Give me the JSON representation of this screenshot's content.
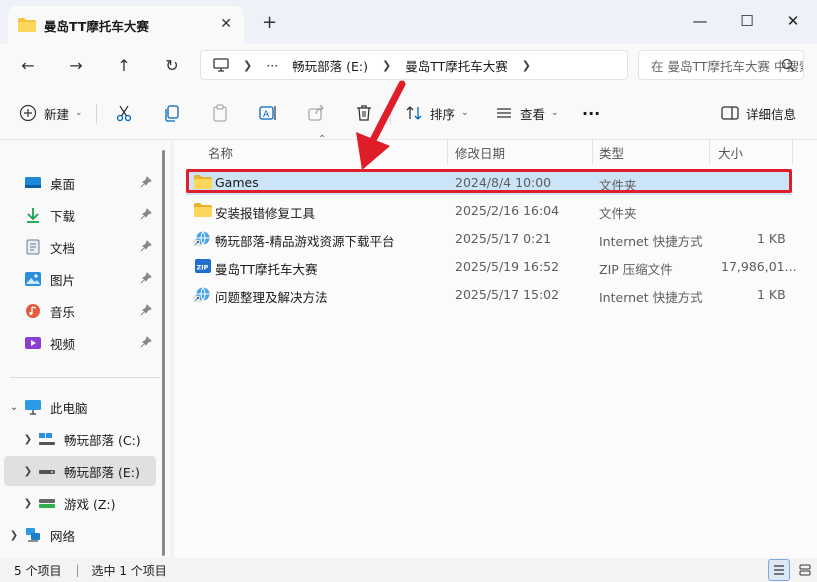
{
  "window": {
    "tab_title": "曼岛TT摩托车大赛",
    "new_tab": "+",
    "tab_close": "✕",
    "minimize": "—",
    "maximize": "☐",
    "close": "✕"
  },
  "nav": {
    "back": "←",
    "forward": "→",
    "up": "↑",
    "refresh": "↻",
    "breadcrumb": [
      "畅玩部落 (E:)",
      "曼岛TT摩托车大赛"
    ],
    "ellipsis": "···",
    "search_placeholder": "在 曼岛TT摩托车大赛 中搜索"
  },
  "toolbar": {
    "new_label": "新建",
    "sort_label": "排序",
    "view_label": "查看",
    "more_label": "···",
    "details_label": "详细信息"
  },
  "sidebar": {
    "quick": [
      {
        "label": "桌面",
        "icon": "desktop-icon"
      },
      {
        "label": "下载",
        "icon": "download-icon"
      },
      {
        "label": "文档",
        "icon": "document-icon"
      },
      {
        "label": "图片",
        "icon": "pictures-icon"
      },
      {
        "label": "音乐",
        "icon": "music-icon"
      },
      {
        "label": "视频",
        "icon": "video-icon"
      }
    ],
    "this_pc": "此电脑",
    "drives": [
      {
        "label": "畅玩部落 (C:)"
      },
      {
        "label": "畅玩部落 (E:)"
      },
      {
        "label": "游戏 (Z:)"
      }
    ],
    "network": "网络"
  },
  "columns": {
    "name": "名称",
    "date": "修改日期",
    "type": "类型",
    "size": "大小"
  },
  "files": [
    {
      "name": "Games",
      "date": "2024/8/4 10:00",
      "type": "文件夹",
      "size": ""
    },
    {
      "name": "安装报错修复工具",
      "date": "2025/2/16 16:04",
      "type": "文件夹",
      "size": ""
    },
    {
      "name": "畅玩部落-精品游戏资源下载平台",
      "date": "2025/5/17 0:21",
      "type": "Internet 快捷方式",
      "size": "1 KB"
    },
    {
      "name": "曼岛TT摩托车大赛",
      "date": "2025/5/19 16:52",
      "type": "ZIP 压缩文件",
      "size": "17,986,01..."
    },
    {
      "name": "问题整理及解决方法",
      "date": "2025/5/17 15:02",
      "type": "Internet 快捷方式",
      "size": "1 KB"
    }
  ],
  "status": {
    "count": "5 个项目",
    "selected": "选中 1 个项目"
  },
  "colors": {
    "accent": "#0067c0",
    "selection": "#cce4f7",
    "highlight_box": "#e01e2a",
    "folder": "#f5c440"
  }
}
